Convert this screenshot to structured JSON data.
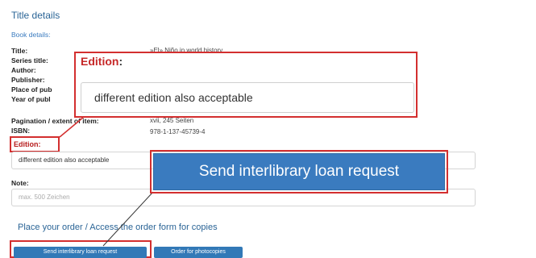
{
  "section_title": "Title details",
  "book_details_label": "Book details:",
  "details": [
    {
      "label": "Title:",
      "value": "»El» Niño in world history"
    },
    {
      "label": "Series title:",
      "value": ""
    },
    {
      "label": "Author:",
      "value": ""
    },
    {
      "label": "Publisher:",
      "value": ""
    },
    {
      "label": "Place of pub",
      "value": ""
    },
    {
      "label": "Year of publ",
      "value": ""
    },
    {
      "label": "Pagination / extent of item:",
      "value": "xvii, 245 Seiten"
    },
    {
      "label": "ISBN:",
      "value": "978-1-137-45739-4"
    }
  ],
  "edition": {
    "label": "Edition:",
    "value": "different edition also acceptable"
  },
  "note": {
    "label": "Note:",
    "placeholder": "max. 500 Zeichen"
  },
  "order_heading": "Place your order / Access the order form for copies",
  "buttons": {
    "send_ill": "Send interlibrary loan request",
    "photocopies": "Order for photocopies"
  },
  "zoom": {
    "edition_title": "Edition",
    "edition_colon": ":",
    "edition_value": "different edition also acceptable",
    "button_label": "Send interlibrary loan request"
  },
  "colors": {
    "accent_blue": "#3279b7",
    "callout_red": "#d32f2f"
  }
}
